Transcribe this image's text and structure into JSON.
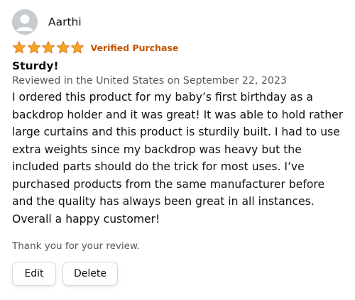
{
  "reviewer": {
    "name": "Aarthi",
    "avatar_icon": "user-avatar-icon"
  },
  "rating": {
    "stars_filled": 5,
    "stars_total": 5,
    "star_color": "#f5a623",
    "verified_label": "Verified Purchase",
    "verified_color": "#c45500"
  },
  "review": {
    "title": "Sturdy!",
    "date": "Reviewed in the United States on September 22, 2023",
    "body": "I ordered this product for my baby’s first birthday as a backdrop holder and it was great! It was able to hold rather large curtains and this product is sturdily built. I had to use extra weights since my backdrop was heavy but the included parts should do the trick for most uses. I’ve purchased products from the same manufacturer before and the quality has always been great in all instances. Overall a happy customer!"
  },
  "footer": {
    "thanks": "Thank you for your review.",
    "edit_label": "Edit",
    "delete_label": "Delete"
  }
}
